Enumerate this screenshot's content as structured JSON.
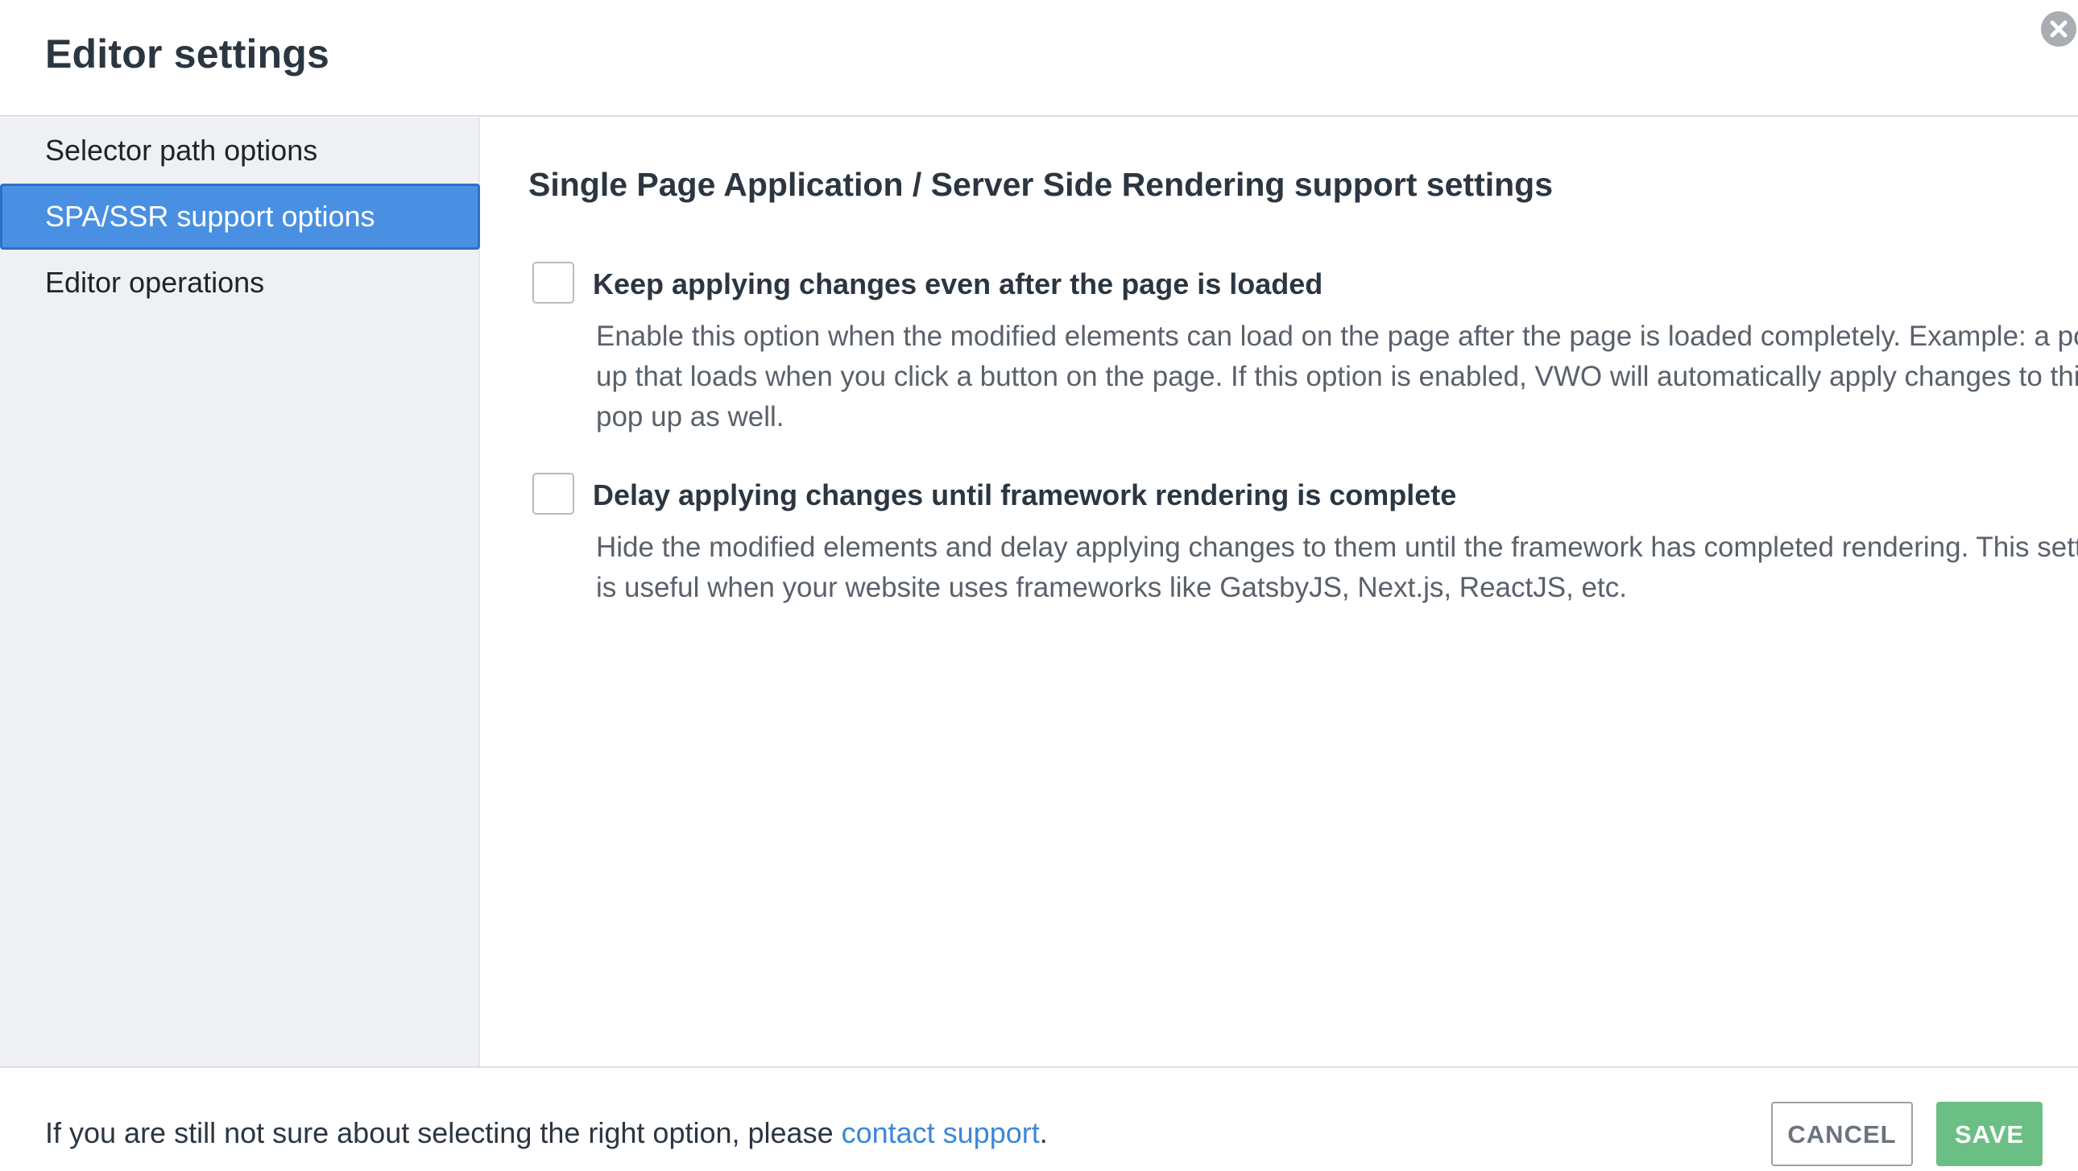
{
  "dialog": {
    "title": "Editor settings",
    "close_icon": "close-circle-icon"
  },
  "sidebar": {
    "items": [
      {
        "label": "Selector path options",
        "active": false
      },
      {
        "label": "SPA/SSR support options",
        "active": true
      },
      {
        "label": "Editor operations",
        "active": false
      }
    ]
  },
  "content": {
    "section_title": "Single Page Application / Server Side Rendering support settings",
    "options": [
      {
        "label": "Keep applying changes even after the page is loaded",
        "checked": false,
        "description": "Enable this option when the modified elements can load on the page after the page is loaded completely. Example: a pop-up that loads when you click a button on the page. If this option is enabled, VWO will automatically apply changes to this pop up as well."
      },
      {
        "label": "Delay applying changes until framework rendering is complete",
        "checked": false,
        "description": "Hide the modified elements and delay applying changes to them until the framework has completed rendering. This setting is useful when your website uses frameworks like GatsbyJS, Next.js, ReactJS, etc."
      }
    ]
  },
  "footer": {
    "help_text_before": "If you are still not sure about selecting the right option, please ",
    "help_link": "contact support",
    "help_text_after": ".",
    "cancel_label": "CANCEL",
    "save_label": "SAVE"
  },
  "colors": {
    "accent": "#4a90e2",
    "save": "#6cbf84",
    "link": "#3b87d8",
    "sidebar_bg": "#eef0f3"
  }
}
